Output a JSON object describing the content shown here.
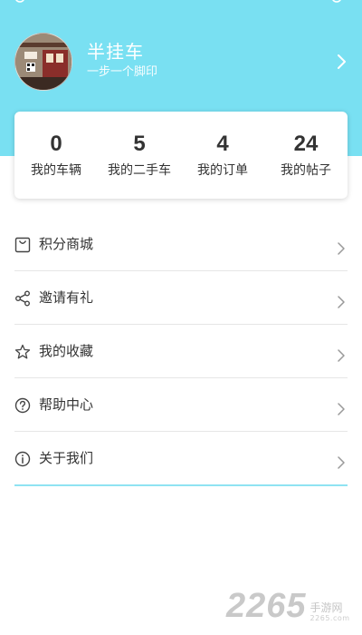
{
  "header": {
    "user_name": "半挂车",
    "motto": "一步一个脚印"
  },
  "stats": [
    {
      "value": "0",
      "label": "我的车辆"
    },
    {
      "value": "5",
      "label": "我的二手车"
    },
    {
      "value": "4",
      "label": "我的订单"
    },
    {
      "value": "24",
      "label": "我的帖子"
    }
  ],
  "menu": [
    {
      "label": "积分商城",
      "icon": "shopping-bag-icon"
    },
    {
      "label": "邀请有礼",
      "icon": "share-icon"
    },
    {
      "label": "我的收藏",
      "icon": "star-icon"
    },
    {
      "label": "帮助中心",
      "icon": "question-circle-icon"
    },
    {
      "label": "关于我们",
      "icon": "info-circle-icon"
    }
  ],
  "watermark": {
    "number": "2265",
    "text": "手游网",
    "url": "2265.com"
  },
  "colors": {
    "header_bg": "#79e0f2",
    "text": "#333333",
    "divider": "#e6e6e6"
  }
}
